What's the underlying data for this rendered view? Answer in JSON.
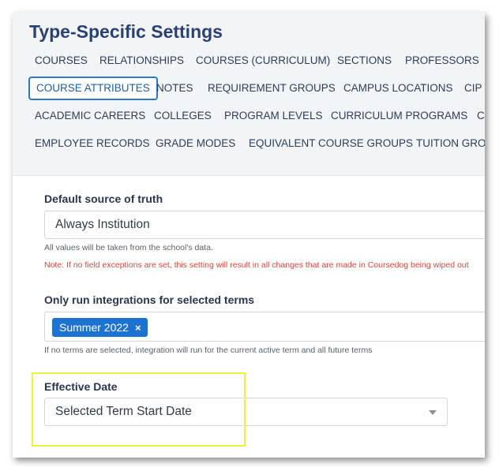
{
  "title": "Type-Specific Settings",
  "tabs": {
    "row1": [
      "COURSES",
      "RELATIONSHIPS",
      "COURSES (CURRICULUM)",
      "SECTIONS",
      "PROFESSORS"
    ],
    "row2": [
      "COURSE ATTRIBUTES",
      "NOTES",
      "REQUIREMENT GROUPS",
      "CAMPUS LOCATIONS",
      "CIP C"
    ],
    "row3": [
      "ACADEMIC CAREERS",
      "COLLEGES",
      "PROGRAM LEVELS",
      "CURRICULUM PROGRAMS",
      "C"
    ],
    "row4": [
      "EMPLOYEE RECORDS",
      "GRADE MODES",
      "EQUIVALENT COURSE GROUPS",
      "TUITION GROU"
    ],
    "active": "COURSE ATTRIBUTES"
  },
  "source_of_truth": {
    "label": "Default source of truth",
    "value": "Always Institution",
    "help": "All values will be taken from the school's data.",
    "note": "Note: If no field exceptions are set, this setting will result in all changes that are made in Coursedog being wiped out"
  },
  "integration_terms": {
    "label": "Only run integrations for selected terms",
    "tags": [
      "Summer 2022"
    ],
    "remove_symbol": "×",
    "help": "If no terms are selected, integration will run for the current active term and all future terms"
  },
  "effective_date": {
    "label": "Effective Date",
    "value": "Selected Term Start Date"
  },
  "colors": {
    "title": "#2b4170",
    "accent": "#1e73d0",
    "note": "#e0453a",
    "highlight": "#f1f03e"
  }
}
